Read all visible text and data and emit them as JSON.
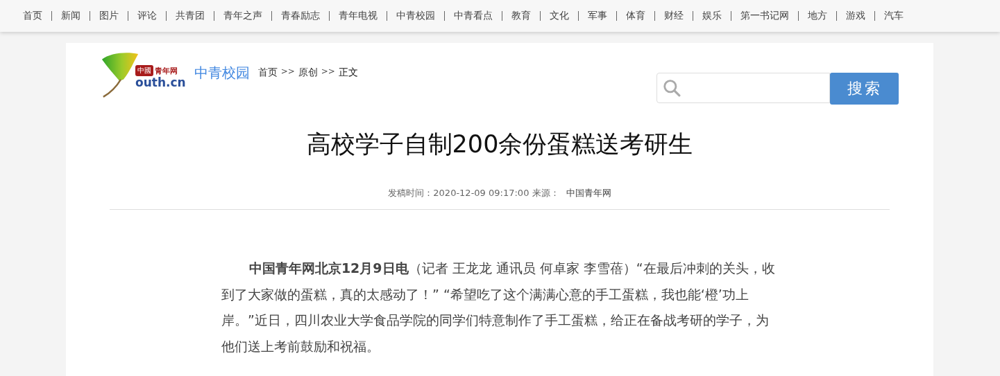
{
  "nav": [
    {
      "label": "首页"
    },
    {
      "label": "新闻"
    },
    {
      "label": "图片"
    },
    {
      "label": "评论"
    },
    {
      "label": "共青团"
    },
    {
      "label": "青年之声"
    },
    {
      "label": "青春励志"
    },
    {
      "label": "青年电视"
    },
    {
      "label": "中青校园"
    },
    {
      "label": "中青看点"
    },
    {
      "label": "教育"
    },
    {
      "label": "文化"
    },
    {
      "label": "军事"
    },
    {
      "label": "体育"
    },
    {
      "label": "财经"
    },
    {
      "label": "娱乐"
    },
    {
      "label": "第一书记网"
    },
    {
      "label": "地方"
    },
    {
      "label": "游戏"
    },
    {
      "label": "汽车"
    }
  ],
  "logo": {
    "badge": "中國",
    "name": "青年网",
    "domain": "outh.cn"
  },
  "channel": "中青校园",
  "breadcrumb": [
    {
      "kind": "link",
      "label": "首页"
    },
    {
      "kind": "separator",
      "label": ">>"
    },
    {
      "kind": "link",
      "label": "原创"
    },
    {
      "kind": "separator",
      "label": ">>"
    },
    {
      "kind": "current",
      "label": "正文"
    }
  ],
  "search": {
    "button": "搜索"
  },
  "article": {
    "title": "高校学子自制200余份蛋糕送考研生",
    "meta": "发稿时间：2020-12-09 09:17:00 来源：",
    "source": "中国青年网",
    "paragraphs": [
      "**中国青年网北京12月9日电**（记者 王龙龙 通讯员 何卓家 李雪蓓）“在最后冲刺的关头，收到了大家做的蛋糕，真的太感动了！” “希望吃了这个满满心意的手工蛋糕，我也能‘橙’功上岸。”近日，四川农业大学食品学院的同学们特意制作了手工蛋糕，给正在备战考研的学子，为他们送上考前鼓励和祝福。"
    ]
  }
}
